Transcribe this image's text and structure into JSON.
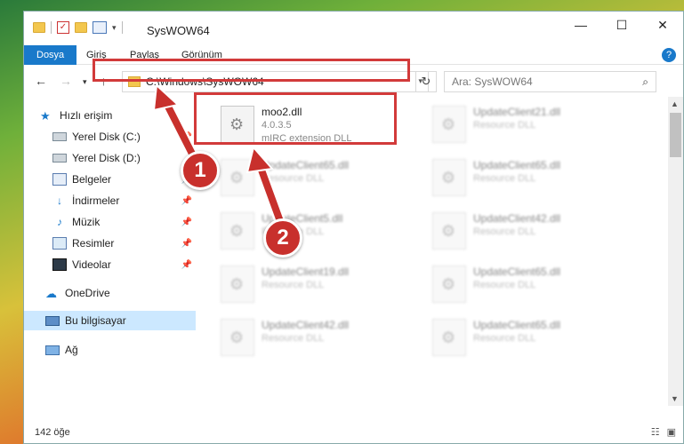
{
  "window": {
    "title": "SysWOW64"
  },
  "ribbon": {
    "tabs": [
      "Dosya",
      "Giriş",
      "Paylaş",
      "Görünüm"
    ]
  },
  "address": {
    "path": "C:\\Windows\\SysWOW64"
  },
  "search": {
    "placeholder": "Ara: SysWOW64"
  },
  "sidebar": {
    "items": [
      {
        "label": "Hızlı erişim",
        "icon": "star-icon"
      },
      {
        "label": "Yerel Disk (C:)",
        "icon": "drive-icon"
      },
      {
        "label": "Yerel Disk (D:)",
        "icon": "drive-icon"
      },
      {
        "label": "Belgeler",
        "icon": "documents-icon"
      },
      {
        "label": "İndirmeler",
        "icon": "download-icon"
      },
      {
        "label": "Müzik",
        "icon": "music-icon"
      },
      {
        "label": "Resimler",
        "icon": "pictures-icon"
      },
      {
        "label": "Videolar",
        "icon": "videos-icon"
      },
      {
        "label": "OneDrive",
        "icon": "cloud-icon"
      },
      {
        "label": "Bu bilgisayar",
        "icon": "computer-icon"
      },
      {
        "label": "Ağ",
        "icon": "network-icon"
      }
    ]
  },
  "files": [
    {
      "name": "moo2.dll",
      "version": "4.0.3.5",
      "description": "mIRC extension DLL"
    },
    {
      "name": "UpdateClient21.dll",
      "description": "Resource DLL"
    },
    {
      "name": "UpdateClient65.dll",
      "description": "Resource DLL"
    },
    {
      "name": "UpdateClient65.dll",
      "description": "Resource DLL"
    },
    {
      "name": "UpdateClient5.dll",
      "description": "Resource DLL"
    },
    {
      "name": "UpdateClient42.dll",
      "description": "Resource DLL"
    },
    {
      "name": "UpdateClient19.dll",
      "description": "Resource DLL"
    },
    {
      "name": "UpdateClient65.dll",
      "description": "Resource DLL"
    },
    {
      "name": "UpdateClient42.dll",
      "description": "Resource DLL"
    },
    {
      "name": "UpdateClient65.dll",
      "description": "Resource DLL"
    }
  ],
  "status": {
    "count": "142 öğe"
  },
  "annotations": {
    "step1": "1",
    "step2": "2"
  },
  "colors": {
    "accent": "#1979ca",
    "highlight": "#d23a3a",
    "selected": "#cce8ff"
  }
}
